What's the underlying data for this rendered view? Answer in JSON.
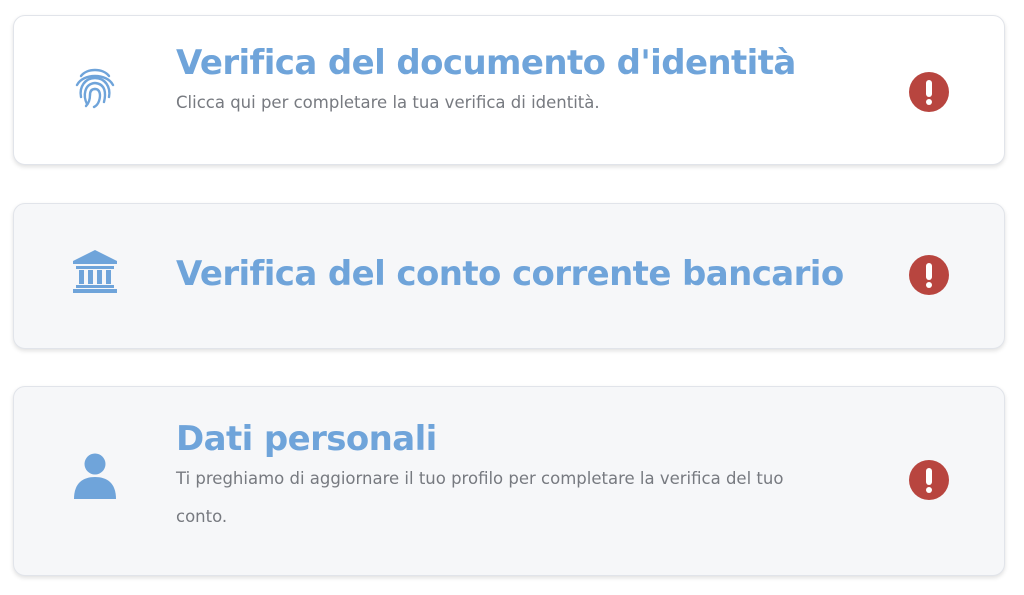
{
  "colors": {
    "title": "#6fa4da",
    "description": "#777a80",
    "icon": "#6fa4da",
    "alert": "#b8453f",
    "card_border": "#e1e4ea"
  },
  "cards": [
    {
      "icon": "fingerprint-icon",
      "status_icon": "exclamation-circle-icon",
      "title": "Verifica del documento d'identità",
      "description": "Clicca qui per completare la tua verifica di identità."
    },
    {
      "icon": "bank-icon",
      "status_icon": "exclamation-circle-icon",
      "title": "Verifica del conto corrente bancario"
    },
    {
      "icon": "user-icon",
      "status_icon": "exclamation-circle-icon",
      "title": "Dati personali",
      "description": "Ti preghiamo di aggiornare il tuo profilo per completare la verifica del tuo conto."
    }
  ]
}
